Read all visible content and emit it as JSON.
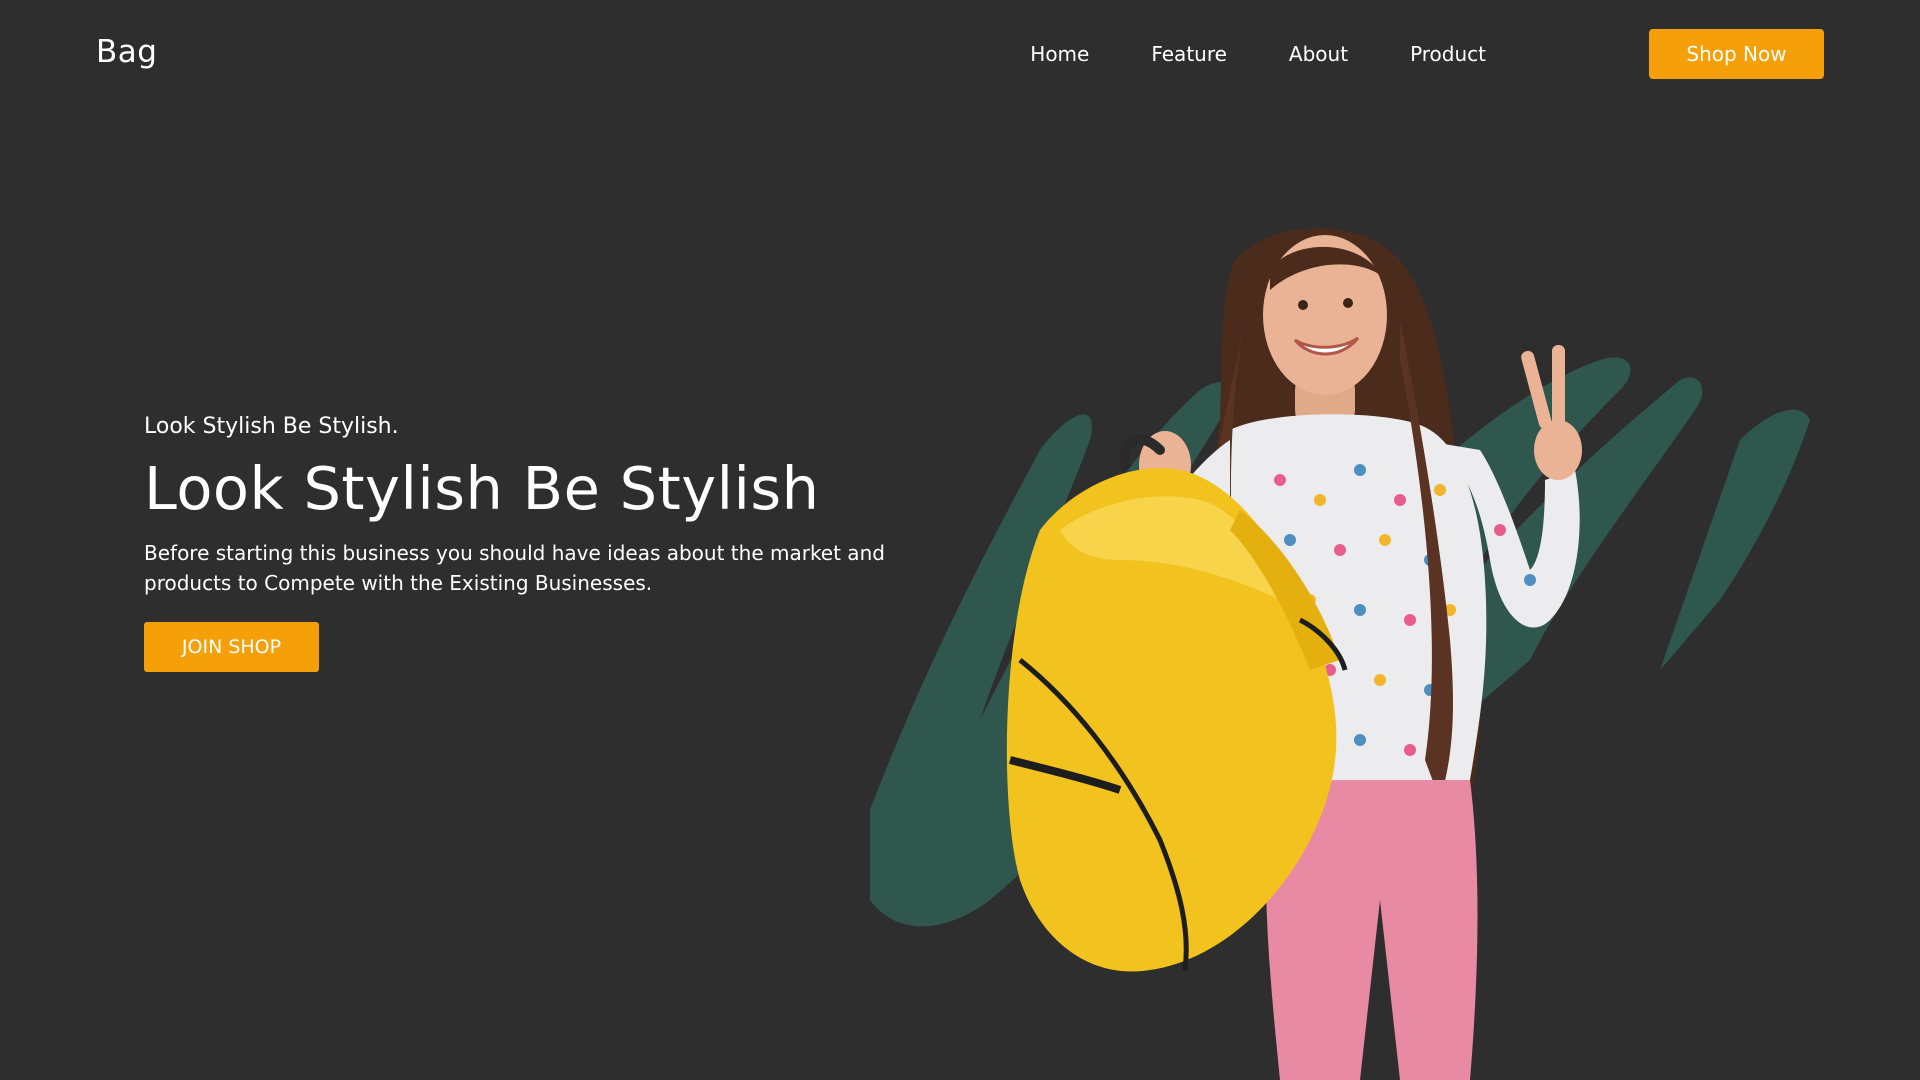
{
  "brand": {
    "logo_text": "Bag"
  },
  "nav": {
    "items": [
      {
        "label": "Home"
      },
      {
        "label": "Feature"
      },
      {
        "label": "About"
      },
      {
        "label": "Product"
      }
    ],
    "cta_label": "Shop Now"
  },
  "hero": {
    "eyebrow": "Look Stylish Be Stylish.",
    "headline": "Look Stylish Be Stylish",
    "description": "Before starting this business you should have ideas about the market and products to Compete with the Existing Businesses.",
    "button_label": "JOIN SHOP",
    "image_subject": "girl-with-yellow-backpack"
  },
  "colors": {
    "background": "#2e2e2f",
    "accent": "#f5a009",
    "brush": "#2f5a50",
    "bag": "#f2c21e",
    "pants": "#e98aa4"
  }
}
